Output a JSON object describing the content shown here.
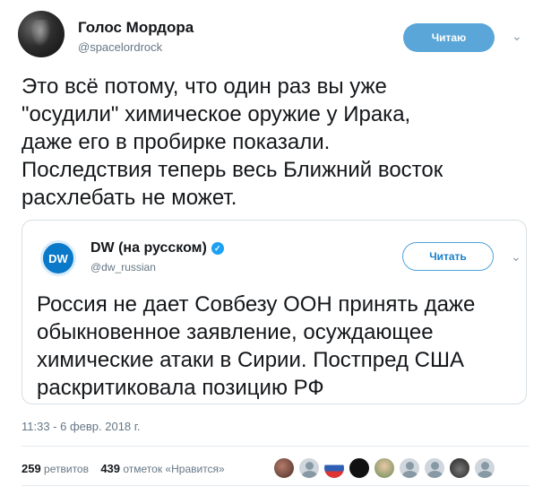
{
  "tweet": {
    "author_name": "Голос Мордора",
    "author_handle": "@spacelordrock",
    "follow_label": "Читаю",
    "text": "Это всё потому, что один раз вы уже\n\"осудили\" химическое оружие у Ирака,\nдаже его в пробирке показали.\nПоследствия теперь весь Ближний восток\nрасхлебать не может.",
    "timestamp": "11:33 - 6 февр. 2018 г.",
    "retweets_count": "259",
    "retweets_label": "ретвитов",
    "likes_count": "439",
    "likes_label": "отметок «Нравится»"
  },
  "quoted_tweet": {
    "author_name": "DW (на русском)",
    "author_handle": "@dw_russian",
    "logo_text": "DW",
    "follow_label": "Читать",
    "text": "Россия не дает Совбезу ООН принять даже\nобыкновенное заявление, осуждающее\nхимические атаки в Сирии. Постпред США\nраскритиковала позицию РФ"
  },
  "icons": {
    "menu": "chevron-down-icon",
    "verified": "verified-badge-icon"
  },
  "colors": {
    "following_button": "#5aa6d8",
    "follow_border": "#4fa2da",
    "dw_blue": "#0b79c9"
  }
}
